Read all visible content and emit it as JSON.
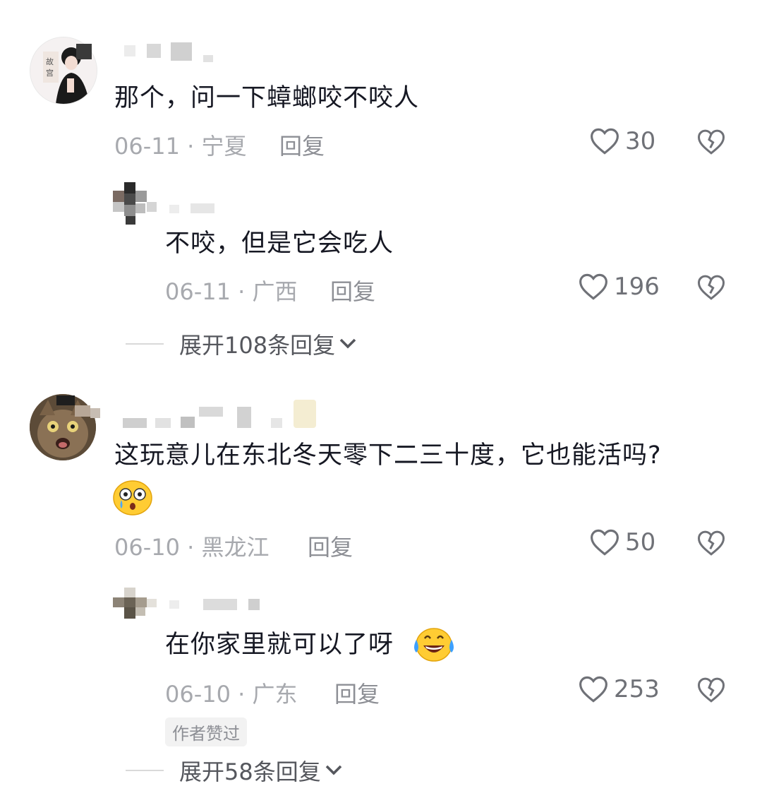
{
  "comments": [
    {
      "text": "那个，问一下蟑螂咬不咬人",
      "date": "06-11",
      "region": "宁夏",
      "reply_label": "回复",
      "likes": "30",
      "replies": [
        {
          "text": "不咬，但是它会吃人",
          "date": "06-11",
          "region": "广西",
          "reply_label": "回复",
          "likes": "196"
        }
      ],
      "expand_label": "展开108条回复"
    },
    {
      "text": "这玩意儿在东北冬天零下二三十度，它也能活吗?",
      "emoji": "flushed-tear-face",
      "date": "06-10",
      "region": "黑龙江",
      "reply_label": "回复",
      "likes": "50",
      "replies": [
        {
          "text": "在你家里就可以了呀",
          "emoji": "laughing-tears-face",
          "date": "06-10",
          "region": "广东",
          "reply_label": "回复",
          "likes": "253",
          "badge": "作者赞过"
        }
      ],
      "expand_label": "展开58条回复"
    }
  ],
  "separator": " · ",
  "icons": {
    "like": "heart-outline-icon",
    "dislike": "broken-heart-icon",
    "expand": "chevron-down-icon"
  },
  "colors": {
    "text": "#161823",
    "meta": "#a7a9ae",
    "icon": "#6f7177"
  }
}
